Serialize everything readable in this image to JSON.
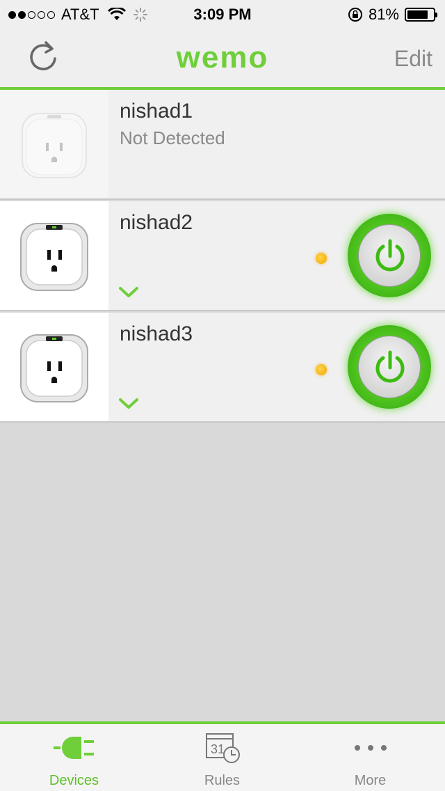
{
  "status_bar": {
    "carrier": "AT&T",
    "time": "3:09 PM",
    "battery": "81%",
    "battery_level": 0.81,
    "signal_bars": 2,
    "signal_total": 5
  },
  "nav": {
    "logo": "wemo",
    "edit_label": "Edit",
    "refresh_icon": "refresh-icon"
  },
  "devices": [
    {
      "name": "nishad1",
      "status": "Not Detected",
      "detected": false
    },
    {
      "name": "nishad2",
      "status": "",
      "detected": true,
      "power_on": true
    },
    {
      "name": "nishad3",
      "status": "",
      "detected": true,
      "power_on": true
    }
  ],
  "tabs": [
    {
      "label": "Devices",
      "icon": "plug-icon",
      "active": true
    },
    {
      "label": "Rules",
      "icon": "calendar-clock-icon",
      "active": false
    },
    {
      "label": "More",
      "icon": "more-icon",
      "active": false
    }
  ],
  "colors": {
    "accent": "#6fcf3a",
    "power_on": "#4fc41f",
    "indicator": "#f2a800"
  }
}
